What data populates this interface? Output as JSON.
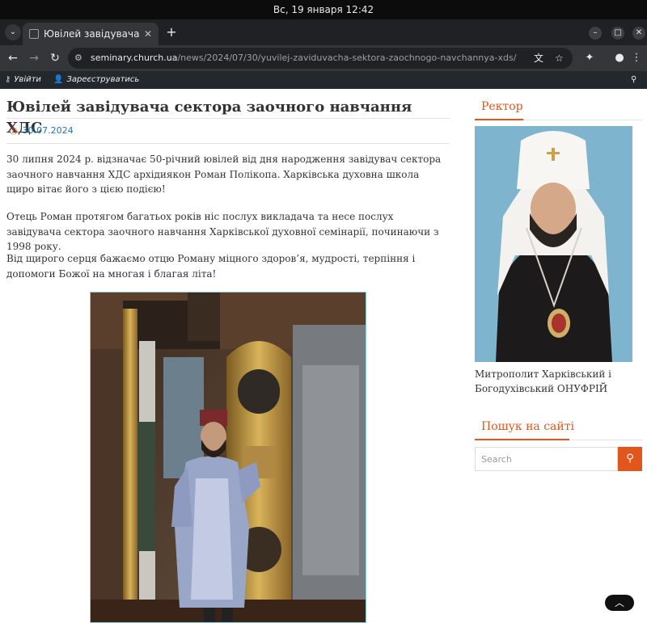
{
  "system": {
    "clock": "Вс, 19 января  12:42"
  },
  "browser": {
    "tab_title": "Ювілей завідувача сект",
    "tab_close": "✕",
    "new_tab": "+",
    "url_host": "seminary.church.ua",
    "url_path": "/news/2024/07/30/yuvilej-zaviduvacha-sektora-zaochnogo-navchannya-xds/"
  },
  "adminbar": {
    "login": "Увійти",
    "register": "Зареєструватись"
  },
  "article": {
    "title": "Ювілей завідувача сектора заочного навчання ХДС",
    "date": "30.07.2024",
    "paragraphs": [
      "30 липня 2024 р. відзначає 50-річний ювілей від дня народження завідувач сектора заочного навчання ХДС архідиякон Роман Полікопа. Харківська духовна школа щиро вітає його з цією подією!",
      "Отець Роман протягом багатьох років ніс послух викладача та несе послух завідувача сектора заочного навчання Харківської духовної семінарії, починаючи з 1998 року.",
      "Від щирого серця бажаємо отцю Роману міцного здоров’я, мудрості, терпіння і допомоги Божої на многая і благая літа!"
    ]
  },
  "sidebar": {
    "rector_title": "Ректор",
    "rector_caption": "Митрополит Харківський і Богодухівський ОНУФРІЙ",
    "search_title": "Пошук на сайті",
    "search_placeholder": "Search"
  },
  "colors": {
    "accent": "#e0561d",
    "link": "#1e73be",
    "adminbar": "#23282d"
  },
  "icons": [
    "chevron-down-icon",
    "favicon-icon",
    "close-icon",
    "plus-icon",
    "back-icon",
    "forward-icon",
    "reload-icon",
    "site-settings-icon",
    "translate-icon",
    "bookmark-star-icon",
    "extensions-icon",
    "profile-icon",
    "menu-icon",
    "key-icon",
    "user-icon",
    "search-icon",
    "clock-icon",
    "chevron-up-icon"
  ]
}
